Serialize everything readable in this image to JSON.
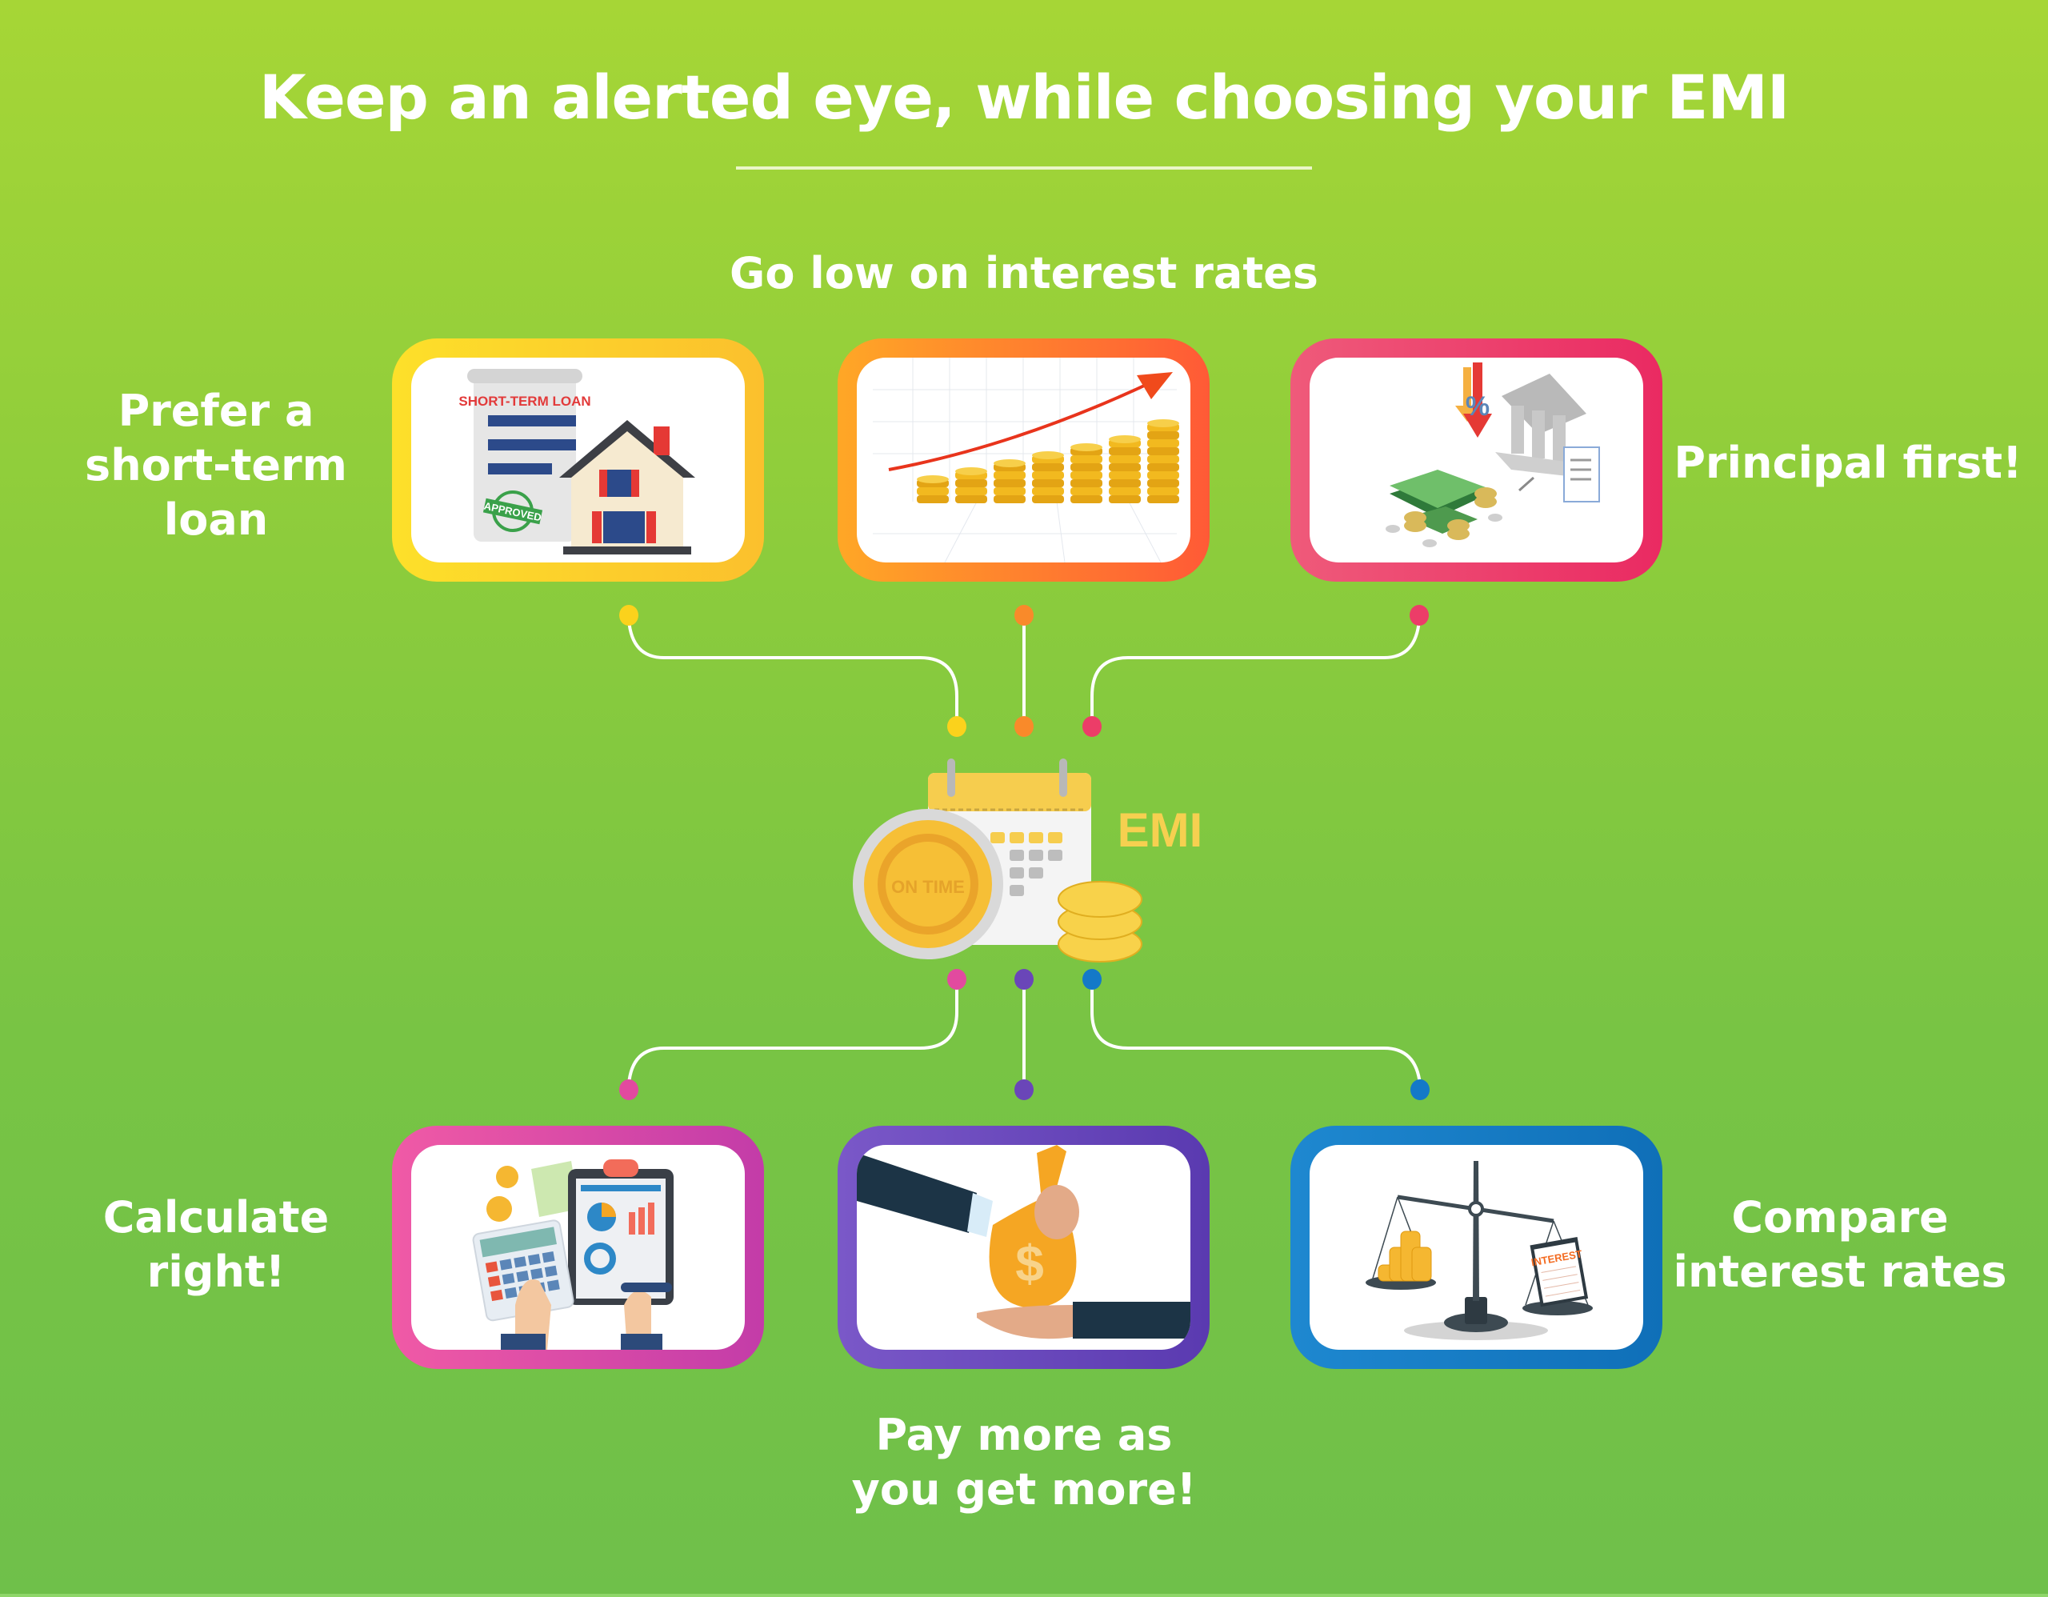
{
  "header": {
    "title": "Keep an alerted eye, while choosing your EMI"
  },
  "center": {
    "emi_label": "EMI",
    "coin_label": "ON TIME"
  },
  "tips": [
    {
      "id": "short-term-loan",
      "label": "Prefer a\nshort-term\nloan",
      "color_start": "#fde02a",
      "color_end": "#fbc02d",
      "illustration": "loan-document-house-icon",
      "art_text": "SHORT-TERM LOAN",
      "stamp_text": "APPROVED"
    },
    {
      "id": "low-interest",
      "label": "Go low on interest rates",
      "color_start": "#ffa726",
      "color_end": "#ff5a36",
      "illustration": "coin-stacks-growth-icon"
    },
    {
      "id": "principal-first",
      "label": "Principal first!",
      "color_start": "#ef5a7a",
      "color_end": "#ea2a62",
      "illustration": "bank-money-icon"
    },
    {
      "id": "calculate-right",
      "label": "Calculate\nright!",
      "color_start": "#f05aa6",
      "color_end": "#c33ca8",
      "illustration": "calculator-report-icon"
    },
    {
      "id": "pay-more",
      "label": "Pay more as\nyou get more!",
      "color_start": "#7a58c8",
      "color_end": "#5a3ab0",
      "illustration": "money-bag-handover-icon"
    },
    {
      "id": "compare-rates",
      "label": "Compare\ninterest rates",
      "color_start": "#1e88d0",
      "color_end": "#0f6fb8",
      "illustration": "balance-scale-icon",
      "art_text": "INTEREST"
    }
  ],
  "connector_colors": {
    "yellow": "#fbd21c",
    "orange": "#f98a2a",
    "red": "#ec3d68",
    "pink": "#e24a9f",
    "purple": "#6a46b8",
    "blue": "#1479c8"
  }
}
